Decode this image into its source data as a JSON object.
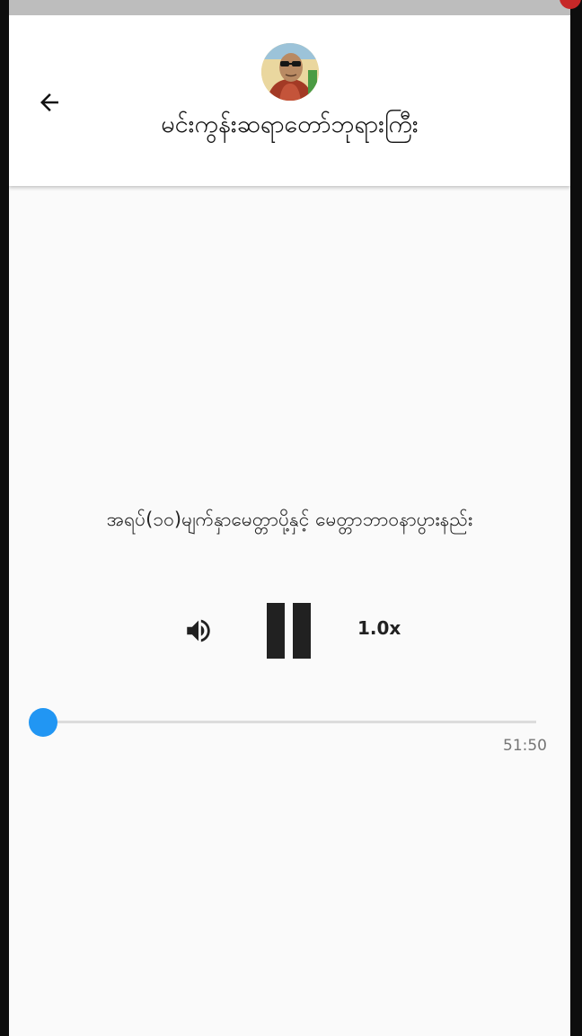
{
  "app_bar": {
    "title": "မင်းကွန်းဆရာတော်ဘုရားကြီး",
    "back_icon": "arrow-left-icon"
  },
  "player": {
    "track_title": "အရပ်(၁၀)မျက်နှာမေတ္တာပို့နှင့် မေတ္တာဘာဝနာပွားနည်း",
    "volume_icon": "volume-up-icon",
    "state_icon": "pause-icon",
    "speed_label": "1.0x",
    "duration": "51:50",
    "progress": 0.0
  },
  "colors": {
    "accent": "#2196f3",
    "track": "#dcdcdc",
    "background": "#fafafa",
    "app_bar": "#ffffff"
  }
}
